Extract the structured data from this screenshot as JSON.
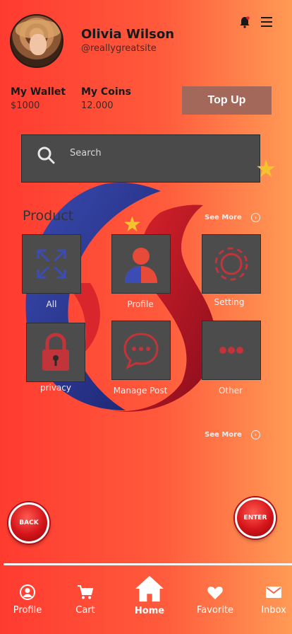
{
  "user": {
    "name": "Olivia Wilson",
    "handle": "@reallygreatsite"
  },
  "wallet": {
    "wallet_label": "My Wallet",
    "wallet_value": "$1000",
    "coins_label": "My Coins",
    "coins_value": "12.000",
    "topup_label": "Top Up"
  },
  "search": {
    "placeholder": "Search"
  },
  "product": {
    "title": "Product",
    "see_more": "See More",
    "tiles": [
      {
        "label": "All",
        "icon": "expand-arrows-icon"
      },
      {
        "label": "Profile",
        "icon": "person-icon"
      },
      {
        "label": "Setting",
        "icon": "gear-icon"
      },
      {
        "label": "privacy",
        "icon": "lock-icon"
      },
      {
        "label": "Manage Post",
        "icon": "chat-bubble-icon"
      },
      {
        "label": "Other",
        "icon": "more-dots-icon"
      }
    ]
  },
  "bottom_see_more": "See More",
  "buttons": {
    "back": "BACK",
    "enter": "ENTER"
  },
  "nav": [
    {
      "label": "Profile",
      "icon": "user-circle-icon",
      "active": false
    },
    {
      "label": "Cart",
      "icon": "cart-icon",
      "active": false
    },
    {
      "label": "Home",
      "icon": "home-icon",
      "active": true
    },
    {
      "label": "Favorite",
      "icon": "heart-icon",
      "active": false
    },
    {
      "label": "Inbox",
      "icon": "envelope-icon",
      "active": false
    }
  ],
  "colors": {
    "accent_red": "#ff3b30",
    "accent_orange": "#ff9a55",
    "tile_gray": "#4c4c4c",
    "topup_brown": "#a4685a",
    "star_gold": "#f4c430"
  }
}
